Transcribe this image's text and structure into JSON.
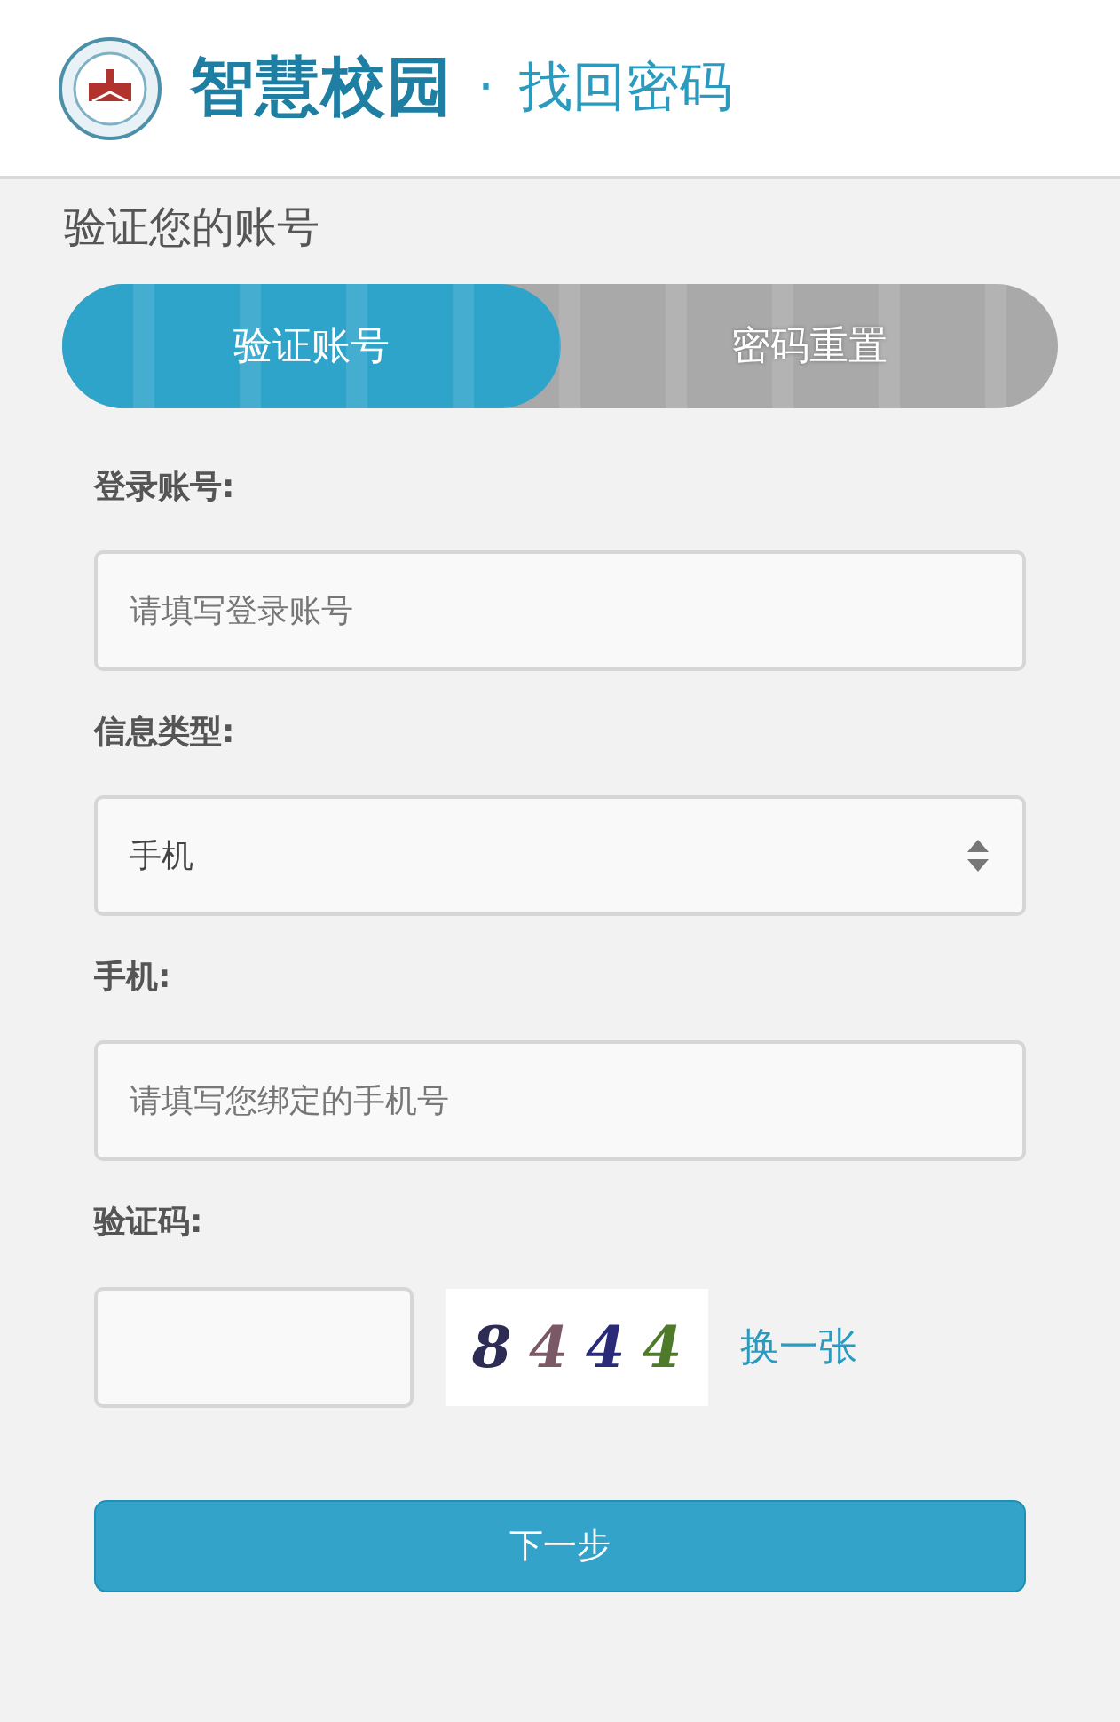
{
  "header": {
    "brand": "智慧校园",
    "separator": "·",
    "title": "找回密码"
  },
  "page_title": "验证您的账号",
  "steps": [
    {
      "label": "验证账号",
      "selected": true
    },
    {
      "label": "密码重置",
      "selected": false
    }
  ],
  "fields": [
    {
      "kind": "text",
      "label": "登录账号:",
      "placeholder": "请填写登录账号"
    },
    {
      "kind": "select",
      "label": "信息类型:",
      "value": "手机"
    },
    {
      "kind": "text",
      "label": "手机:",
      "placeholder": "请填写您绑定的手机号"
    },
    {
      "kind": "captcha",
      "label": "验证码:",
      "captcha": [
        {
          "char": "8",
          "color": "#2c2c54"
        },
        {
          "char": "4",
          "color": "#7a5866"
        },
        {
          "char": "4",
          "color": "#2a2a7a"
        },
        {
          "char": "4",
          "color": "#4e7a2a"
        }
      ],
      "refresh": "换一张"
    }
  ],
  "submit": "下一步"
}
